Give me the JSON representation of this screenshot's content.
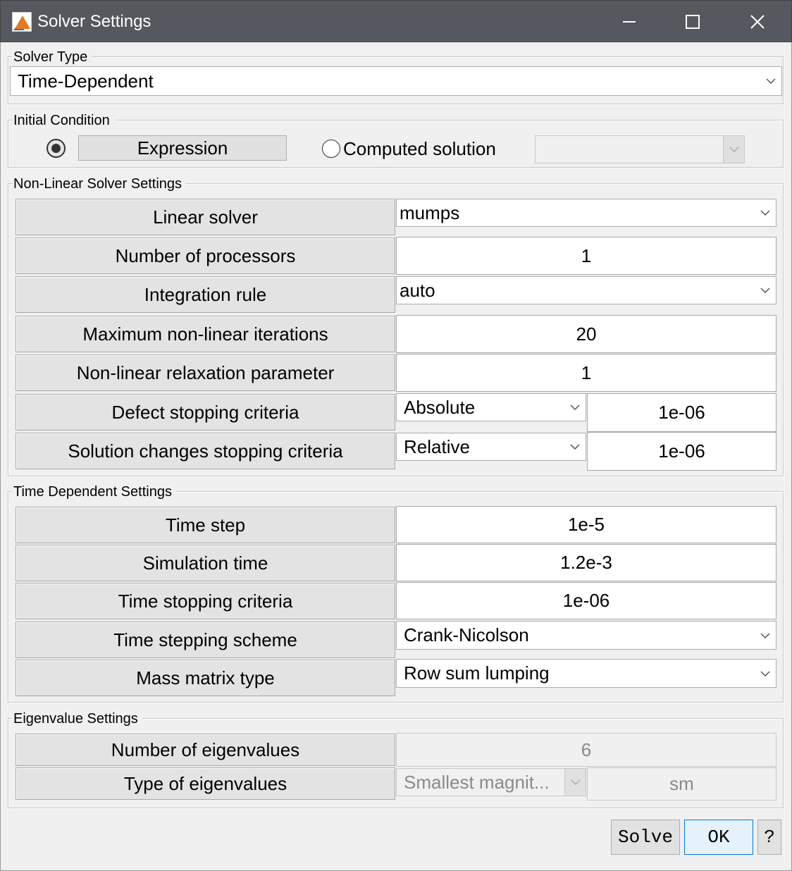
{
  "window": {
    "title": "Solver Settings",
    "controls": {
      "minimize": "minimize-icon",
      "maximize": "maximize-icon",
      "close": "close-icon"
    }
  },
  "solver_type": {
    "group_label": "Solver Type",
    "value": "Time-Dependent"
  },
  "initial_condition": {
    "group_label": "Initial Condition",
    "expression_label": "Expression",
    "expression_selected": true,
    "computed_label": "Computed solution",
    "computed_selected": false,
    "computed_value": ""
  },
  "nonlinear": {
    "group_label": "Non-Linear Solver Settings",
    "linear_solver": {
      "label": "Linear solver",
      "value": "mumps"
    },
    "num_processors": {
      "label": "Number of processors",
      "value": "1"
    },
    "integration_rule": {
      "label": "Integration rule",
      "value": "auto"
    },
    "max_iterations": {
      "label": "Maximum non-linear iterations",
      "value": "20"
    },
    "relaxation": {
      "label": "Non-linear relaxation parameter",
      "value": "1"
    },
    "defect_stopping": {
      "label": "Defect stopping criteria",
      "mode": "Absolute",
      "value": "1e-06"
    },
    "solution_changes": {
      "label": "Solution changes stopping criteria",
      "mode": "Relative",
      "value": "1e-06"
    }
  },
  "time_dependent": {
    "group_label": "Time Dependent Settings",
    "time_step": {
      "label": "Time step",
      "value": "1e-5"
    },
    "simulation_time": {
      "label": "Simulation time",
      "value": "1.2e-3"
    },
    "time_stopping": {
      "label": "Time stopping criteria",
      "value": "1e-06"
    },
    "stepping_scheme": {
      "label": "Time stepping scheme",
      "value": "Crank-Nicolson"
    },
    "mass_matrix": {
      "label": "Mass matrix type",
      "value": "Row sum lumping"
    }
  },
  "eigenvalue": {
    "group_label": "Eigenvalue Settings",
    "num_eigenvalues": {
      "label": "Number of eigenvalues",
      "value": "6"
    },
    "type_eigenvalues": {
      "label": "Type of eigenvalues",
      "mode": "Smallest magnit...",
      "value": "sm"
    }
  },
  "footer": {
    "solve_label": "Solve",
    "ok_label": "OK",
    "help_label": "?"
  },
  "colors": {
    "titlebar": "#56585f",
    "dialog_bg": "#f0f0f0",
    "label_cell": "#e3e3e3",
    "default_button_border": "#0078d7"
  }
}
